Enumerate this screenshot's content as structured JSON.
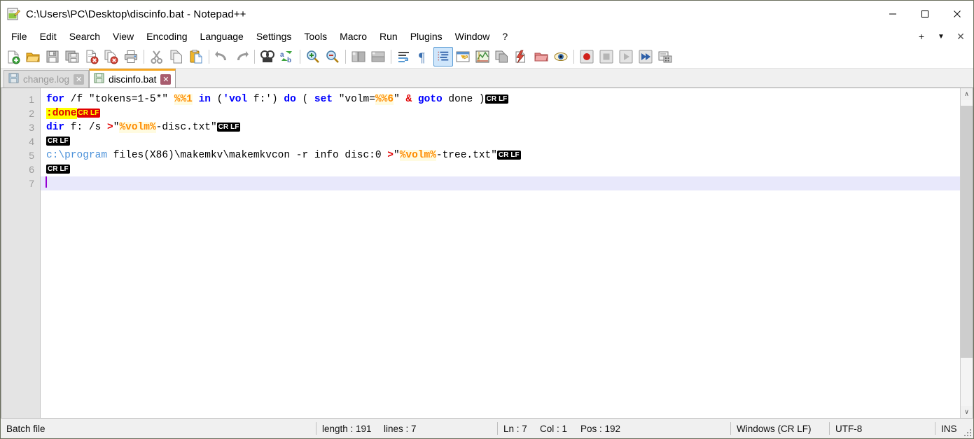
{
  "window": {
    "title": "C:\\Users\\PC\\Desktop\\discinfo.bat - Notepad++",
    "icon": "notepad-plus-plus-icon",
    "minimize_label": "—",
    "maximize_label": "□",
    "close_label": "✕"
  },
  "menubar": {
    "items": [
      {
        "label": "File"
      },
      {
        "label": "Edit"
      },
      {
        "label": "Search"
      },
      {
        "label": "View"
      },
      {
        "label": "Encoding"
      },
      {
        "label": "Language"
      },
      {
        "label": "Settings"
      },
      {
        "label": "Tools"
      },
      {
        "label": "Macro"
      },
      {
        "label": "Run"
      },
      {
        "label": "Plugins"
      },
      {
        "label": "Window"
      },
      {
        "label": "?"
      }
    ],
    "right": {
      "plus_label": "+",
      "chevron_label": "▼",
      "close_label": "✕"
    }
  },
  "toolbar": {
    "buttons": [
      {
        "name": "new-file-icon",
        "group": 0
      },
      {
        "name": "open-file-icon",
        "group": 0
      },
      {
        "name": "save-icon",
        "group": 0
      },
      {
        "name": "save-all-icon",
        "group": 0
      },
      {
        "name": "close-file-icon",
        "group": 0
      },
      {
        "name": "close-all-files-icon",
        "group": 0
      },
      {
        "name": "print-icon",
        "group": 0
      },
      {
        "name": "cut-icon",
        "group": 1
      },
      {
        "name": "copy-icon",
        "group": 1
      },
      {
        "name": "paste-icon",
        "group": 1
      },
      {
        "name": "undo-icon",
        "group": 2
      },
      {
        "name": "redo-icon",
        "group": 2
      },
      {
        "name": "find-icon",
        "group": 3
      },
      {
        "name": "replace-icon",
        "group": 3
      },
      {
        "name": "zoom-in-icon",
        "group": 4
      },
      {
        "name": "zoom-out-icon",
        "group": 4
      },
      {
        "name": "sync-vertical-scroll-icon",
        "group": 5
      },
      {
        "name": "sync-horizontal-scroll-icon",
        "group": 5
      },
      {
        "name": "word-wrap-icon",
        "group": 6
      },
      {
        "name": "show-all-characters-icon",
        "group": 6
      },
      {
        "name": "show-indent-guide-icon",
        "group": 6
      },
      {
        "name": "user-defined-dialog-icon",
        "group": 6
      },
      {
        "name": "document-map-icon",
        "group": 6
      },
      {
        "name": "function-list-icon",
        "group": 6
      },
      {
        "name": "folder-as-workspace-icon",
        "group": 6
      },
      {
        "name": "monitoring-icon",
        "group": 6
      },
      {
        "name": "record-macro-icon",
        "group": 7
      },
      {
        "name": "stop-recording-macro-icon",
        "group": 7
      },
      {
        "name": "play-macro-icon",
        "group": 7
      },
      {
        "name": "run-macro-multiple-icon",
        "group": 7
      },
      {
        "name": "run-icon",
        "group": 7
      }
    ]
  },
  "tabs": [
    {
      "label": "change.log",
      "icon": "save-disk-icon",
      "close_label": "✕",
      "active": false
    },
    {
      "label": "discinfo.bat",
      "icon": "save-disk-icon",
      "close_label": "✕",
      "active": true
    }
  ],
  "editor": {
    "line_numbers": [
      "1",
      "2",
      "3",
      "4",
      "5",
      "6",
      "7"
    ],
    "lines": [
      {
        "number": "1",
        "current": false,
        "tokens": [
          {
            "text": "for",
            "style": "kw"
          },
          {
            "text": " /f \"tokens=1-5*\" ",
            "style": "plain"
          },
          {
            "text": "%%1",
            "style": "var"
          },
          {
            "text": " ",
            "style": "plain"
          },
          {
            "text": "in",
            "style": "kw"
          },
          {
            "text": " (",
            "style": "plain"
          },
          {
            "text": "'vol",
            "style": "kw"
          },
          {
            "text": " f:')",
            "style": "plain"
          },
          {
            "text": " ",
            "style": "plain"
          },
          {
            "text": "do",
            "style": "kw"
          },
          {
            "text": " ( ",
            "style": "plain"
          },
          {
            "text": "set",
            "style": "kw"
          },
          {
            "text": " \"volm=",
            "style": "plain"
          },
          {
            "text": "%%6",
            "style": "var"
          },
          {
            "text": "\" ",
            "style": "plain"
          },
          {
            "text": "&",
            "style": "amp"
          },
          {
            "text": " ",
            "style": "plain"
          },
          {
            "text": "goto",
            "style": "kw"
          },
          {
            "text": " done )",
            "style": "plain"
          },
          {
            "text": "CRLF",
            "style": "crlf"
          }
        ]
      },
      {
        "number": "2",
        "current": false,
        "tokens": [
          {
            "text": ":done",
            "style": "label"
          },
          {
            "text": "CRLF",
            "style": "crlf-yellow"
          }
        ]
      },
      {
        "number": "3",
        "current": false,
        "tokens": [
          {
            "text": "dir",
            "style": "kw"
          },
          {
            "text": " f: /s ",
            "style": "plain"
          },
          {
            "text": ">",
            "style": "redop"
          },
          {
            "text": "\"",
            "style": "plain"
          },
          {
            "text": "%volm%",
            "style": "var"
          },
          {
            "text": "-disc.txt\"",
            "style": "plain"
          },
          {
            "text": "CRLF",
            "style": "crlf"
          }
        ]
      },
      {
        "number": "4",
        "current": false,
        "tokens": [
          {
            "text": "CRLF",
            "style": "crlf"
          }
        ]
      },
      {
        "number": "5",
        "current": false,
        "tokens": [
          {
            "text": "c:\\program",
            "style": "path"
          },
          {
            "text": " files(X86)\\makemkv\\makemkvcon -r info disc:0 ",
            "style": "plain"
          },
          {
            "text": ">",
            "style": "redop"
          },
          {
            "text": "\"",
            "style": "plain"
          },
          {
            "text": "%volm%",
            "style": "var"
          },
          {
            "text": "-tree.txt\"",
            "style": "plain"
          },
          {
            "text": "CRLF",
            "style": "crlf"
          }
        ]
      },
      {
        "number": "6",
        "current": false,
        "tokens": [
          {
            "text": "CRLF",
            "style": "crlf"
          }
        ]
      },
      {
        "number": "7",
        "current": true,
        "tokens": []
      }
    ]
  },
  "scrollbar": {
    "up_arrow": "∧",
    "down_arrow": "∨"
  },
  "statusbar": {
    "language": "Batch file",
    "length": "length : 191",
    "lines": "lines : 7",
    "ln": "Ln : 7",
    "col": "Col : 1",
    "pos": "Pos : 192",
    "eol": "Windows (CR LF)",
    "encoding": "UTF-8",
    "insert_mode": "INS"
  },
  "colors": {
    "accent_tab": "#f5a623",
    "keyword": "#0000ff",
    "variable": "#ff8c00",
    "operator": "#e00000",
    "path": "#4a90d9",
    "label_bg": "#ffff00",
    "current_line": "#e8e8fb",
    "caret": "#9400d3"
  }
}
